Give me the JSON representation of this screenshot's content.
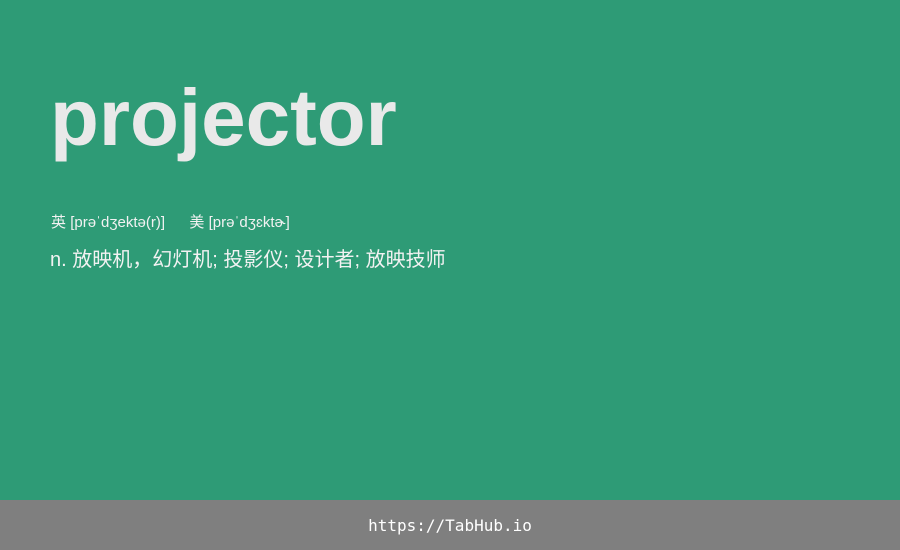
{
  "entry": {
    "word": "projector",
    "phonetics": {
      "uk_label": "英",
      "uk_ipa": "[prəˈdʒektə(r)]",
      "us_label": "美",
      "us_ipa": "[prəˈdʒɛktɚ]"
    },
    "definition": "n. 放映机，幻灯机; 投影仪; 设计者; 放映技师"
  },
  "footer": {
    "link_text": "https://TabHub.io"
  },
  "colors": {
    "background": "#2e9b76",
    "word_text": "#e9e9e9",
    "body_text": "#f2f2f2",
    "footer_bg": "#7f7f7f",
    "footer_text": "#ffffff"
  }
}
